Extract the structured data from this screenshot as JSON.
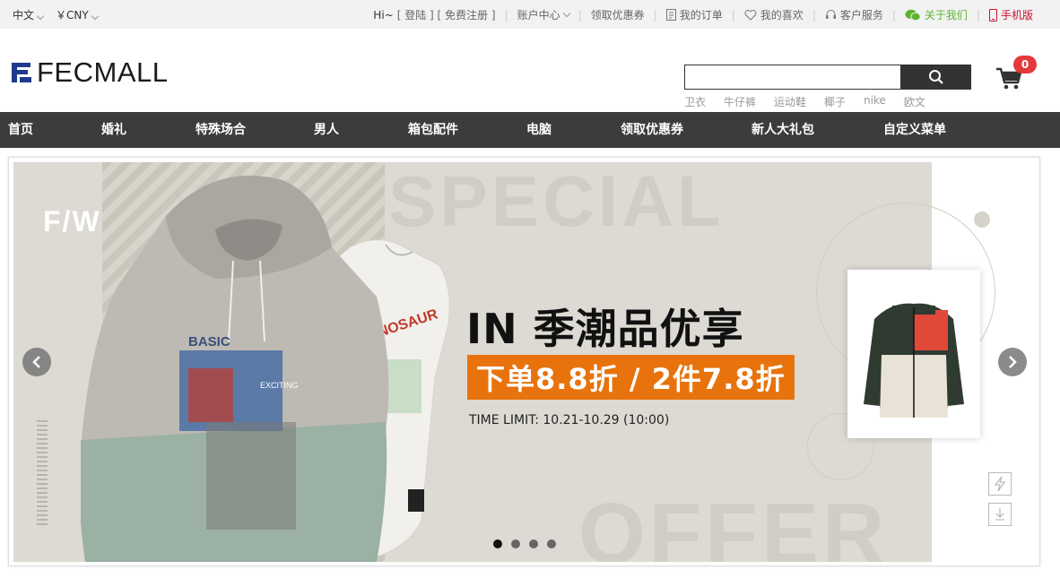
{
  "topbar": {
    "language": "中文",
    "currency": "￥CNY",
    "greeting": "Hi~",
    "login": "登陆",
    "register": "免费注册",
    "account": "账户中心",
    "coupons": "领取优惠券",
    "orders": "我的订单",
    "favorites": "我的喜欢",
    "service": "客户服务",
    "follow": "关于我们",
    "mobile": "手机版"
  },
  "header": {
    "logo_text": "FECMALL",
    "search_placeholder": "",
    "hot_words": [
      "卫衣",
      "牛仔裤",
      "运动鞋",
      "椰子",
      "nike",
      "欧文"
    ],
    "cart_count": "0",
    "icons": {
      "search": "search-icon",
      "cart": "cart-icon"
    }
  },
  "nav": {
    "items": [
      "首页",
      "婚礼",
      "特殊场合",
      "男人",
      "箱包配件",
      "电脑",
      "领取优惠券",
      "新人大礼包",
      "自定义菜单"
    ]
  },
  "banner": {
    "corner_tag": "F/W",
    "bg_word_top": "SPECIAL",
    "bg_word_bottom": "OFFER",
    "hoodie_text": "BASIC",
    "hoodie_sub": "EXCITING",
    "tee_text": "DINOSAUR",
    "headline": "IN 季潮品优享",
    "promo": "下单8.8折 / 2件7.8折",
    "time_limit": "TIME LIMIT: 10.21-10.29 (10:00)",
    "slide_count": 4,
    "active_slide": 0,
    "colors": {
      "promo": "#e8730c",
      "background": "#dcdad2",
      "hoodie_top": "#bdb9b3",
      "hoodie_bottom": "#9bb1a3"
    }
  }
}
